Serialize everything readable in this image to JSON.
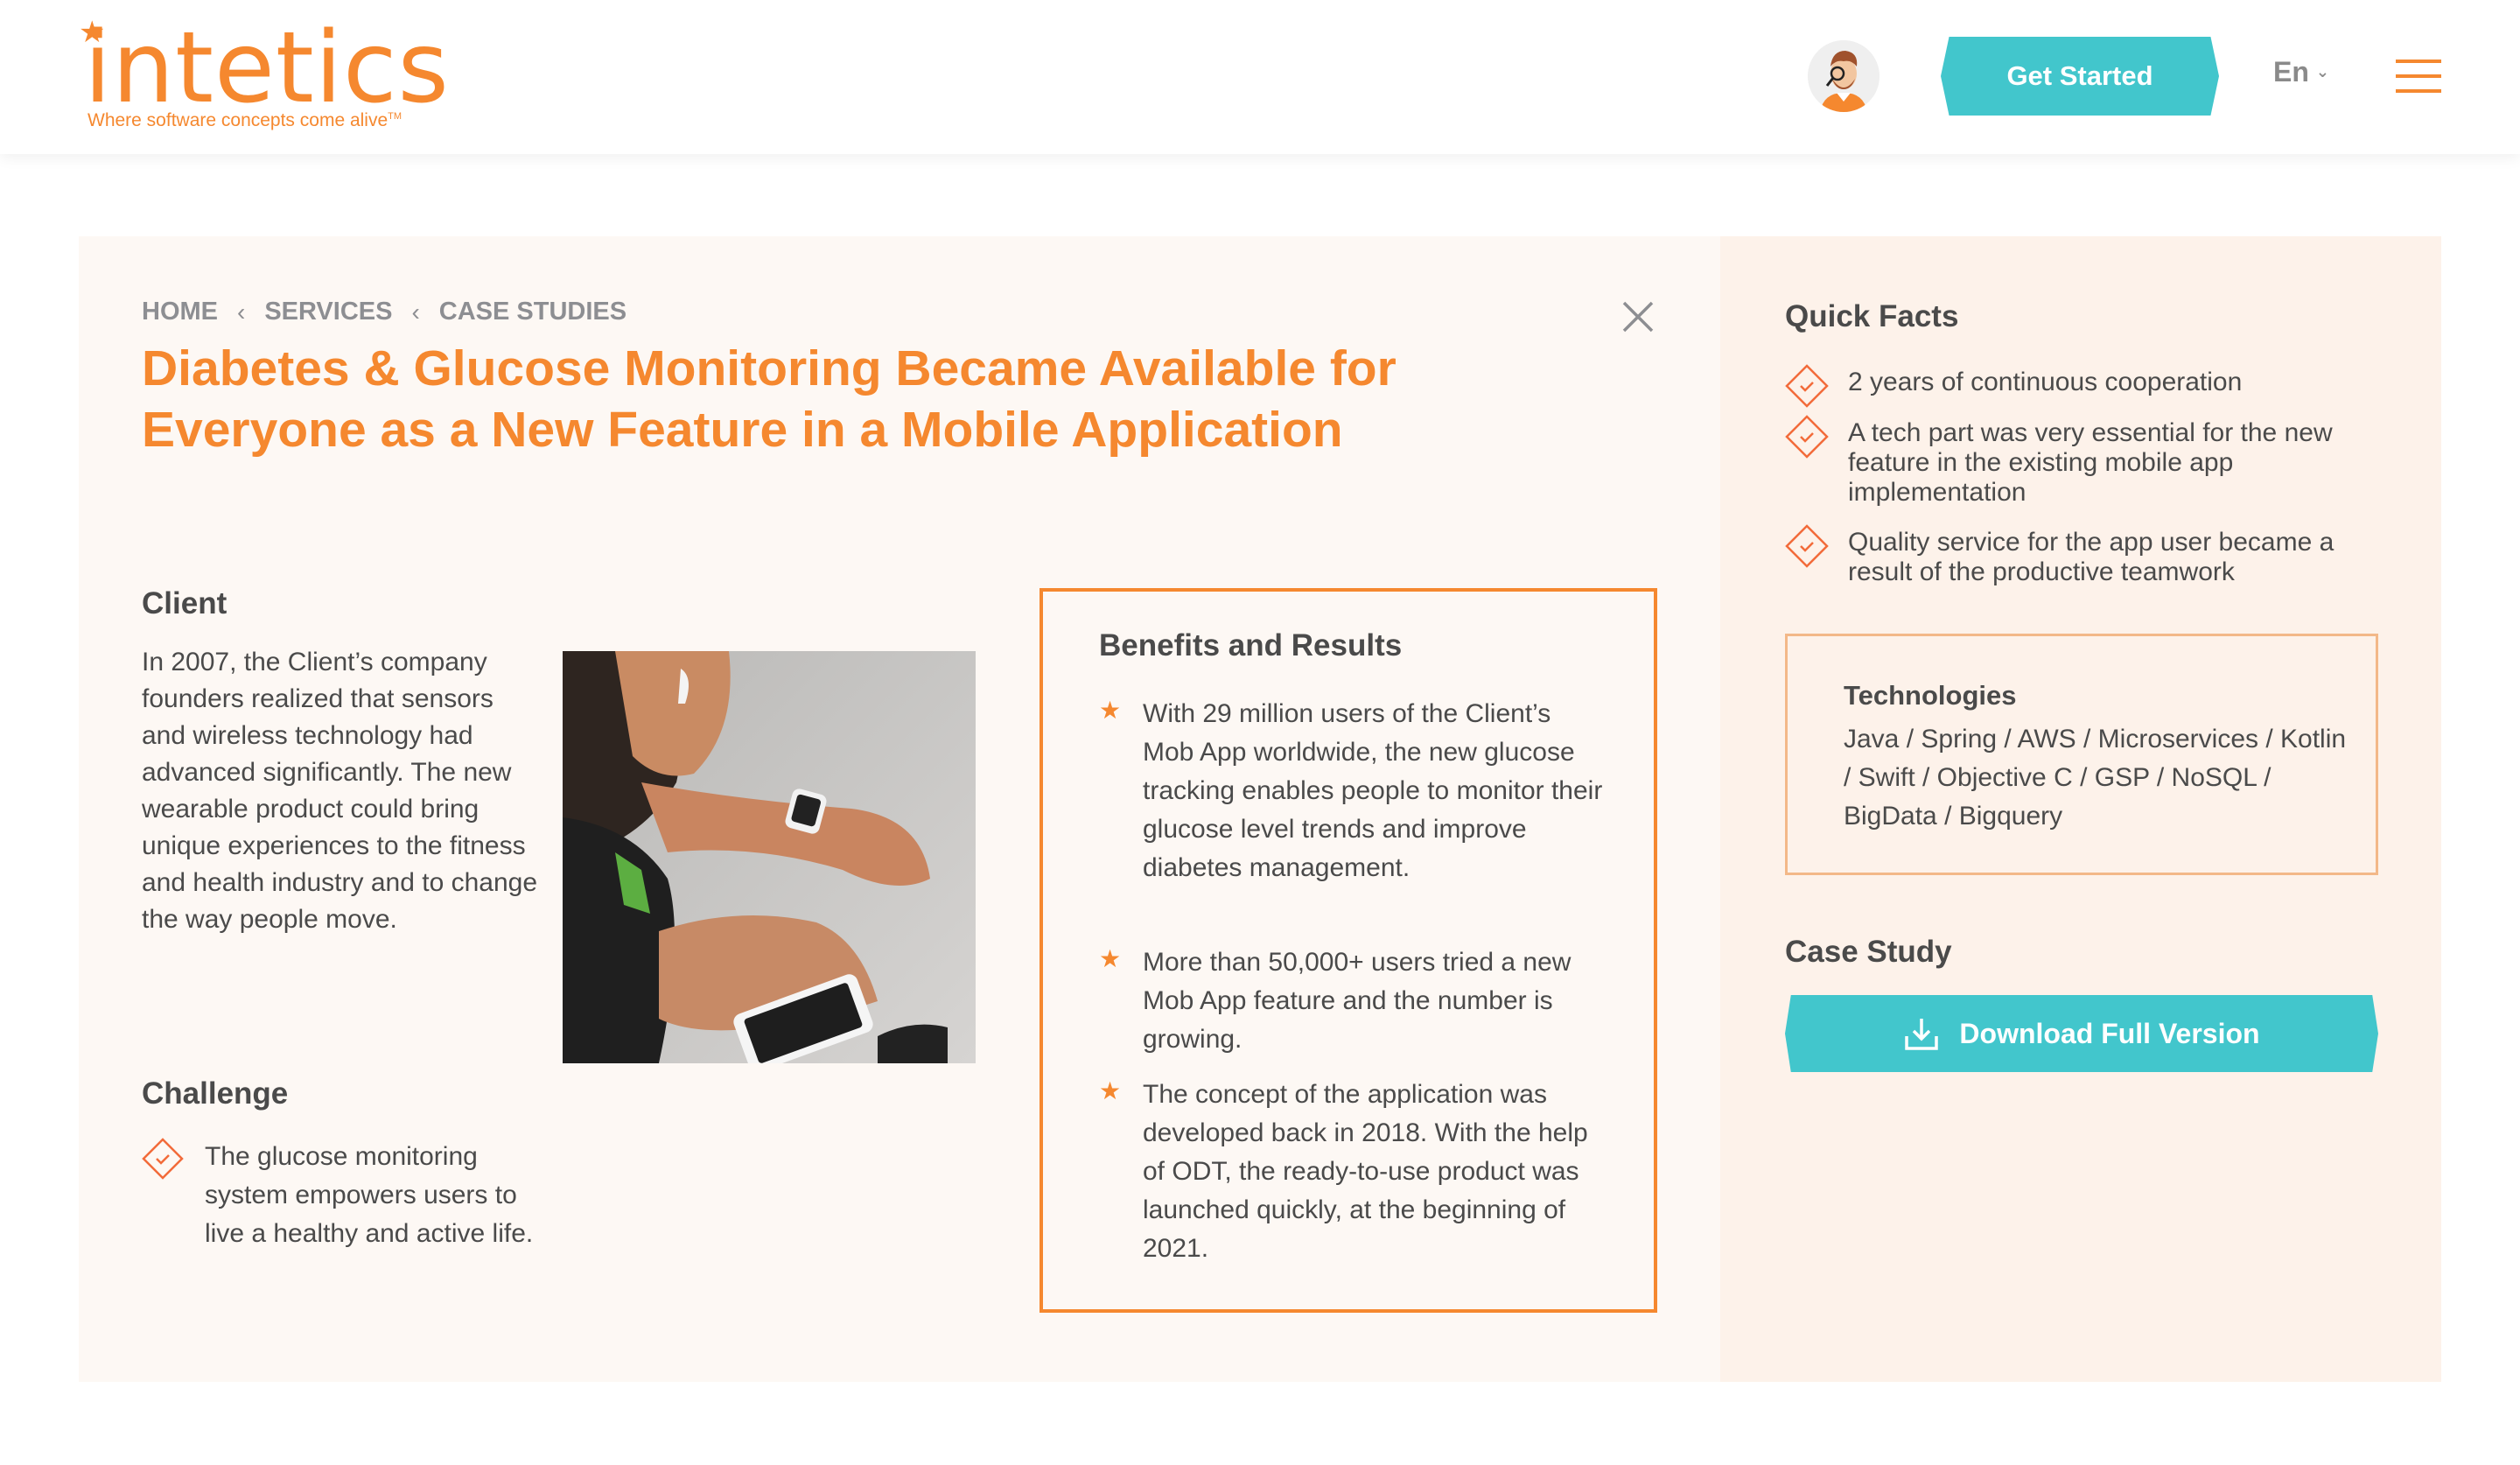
{
  "header": {
    "logo_text": "intetics",
    "logo_tagline": "Where software concepts come alive",
    "logo_tm": "TM",
    "cta_label": "Get Started",
    "language": "En",
    "icons": {
      "avatar": "support-agent-avatar",
      "language_chevron": "chevron-down-icon",
      "menu": "hamburger-menu-icon"
    }
  },
  "colors": {
    "brand_orange": "#f5882f",
    "accent_teal": "#42c6cc",
    "check_icon": "#f26b3a",
    "main_panel_bg": "#fdf8f4",
    "side_panel_bg": "#fdf2ea",
    "text": "#4a4a4a",
    "muted": "#8d8e92"
  },
  "breadcrumb": [
    {
      "label": "HOME"
    },
    {
      "label": "SERVICES"
    },
    {
      "label": "CASE STUDIES"
    }
  ],
  "breadcrumb_separator": "‹",
  "title": "Diabetes & Glucose Monitoring Became Available for Everyone as a New Feature in a Mobile Application",
  "client": {
    "heading": "Client",
    "text": "In 2007, the Client’s company founders realized that sensors and wireless technology had advanced significantly. The new wearable product could bring unique experiences to the fitness and health industry and to change the way people move.",
    "image_alt": "Woman checking smartwatch while holding smartphone"
  },
  "challenge": {
    "heading": "Challenge",
    "items": [
      "The glucose monitoring system empowers users to live a healthy and active life."
    ]
  },
  "benefits": {
    "heading": "Benefits and Results",
    "items": [
      "With 29 million users of the Client’s Mob App worldwide, the new glucose tracking enables people to monitor their glucose level trends and improve diabetes management.",
      "More than 50,000+ users tried a new Mob App feature and the number is growing.",
      "The concept of the application was developed back in 2018. With the help of ODT, the ready-to-use product was launched quickly, at the beginning of 2021."
    ]
  },
  "quick_facts": {
    "heading": "Quick Facts",
    "items": [
      "2 years of continuous cooperation",
      "A tech part was very essential for the new feature in the existing mobile app implementation",
      "Quality service for the app user became a result of the productive teamwork"
    ]
  },
  "technologies": {
    "heading": "Technologies",
    "list": "Java / Spring / AWS / Microservices / Kotlin / Swift / Objective C / GSP / NoSQL / BigData / Bigquery"
  },
  "case_study": {
    "heading": "Case Study",
    "download_label": "Download Full Version"
  }
}
